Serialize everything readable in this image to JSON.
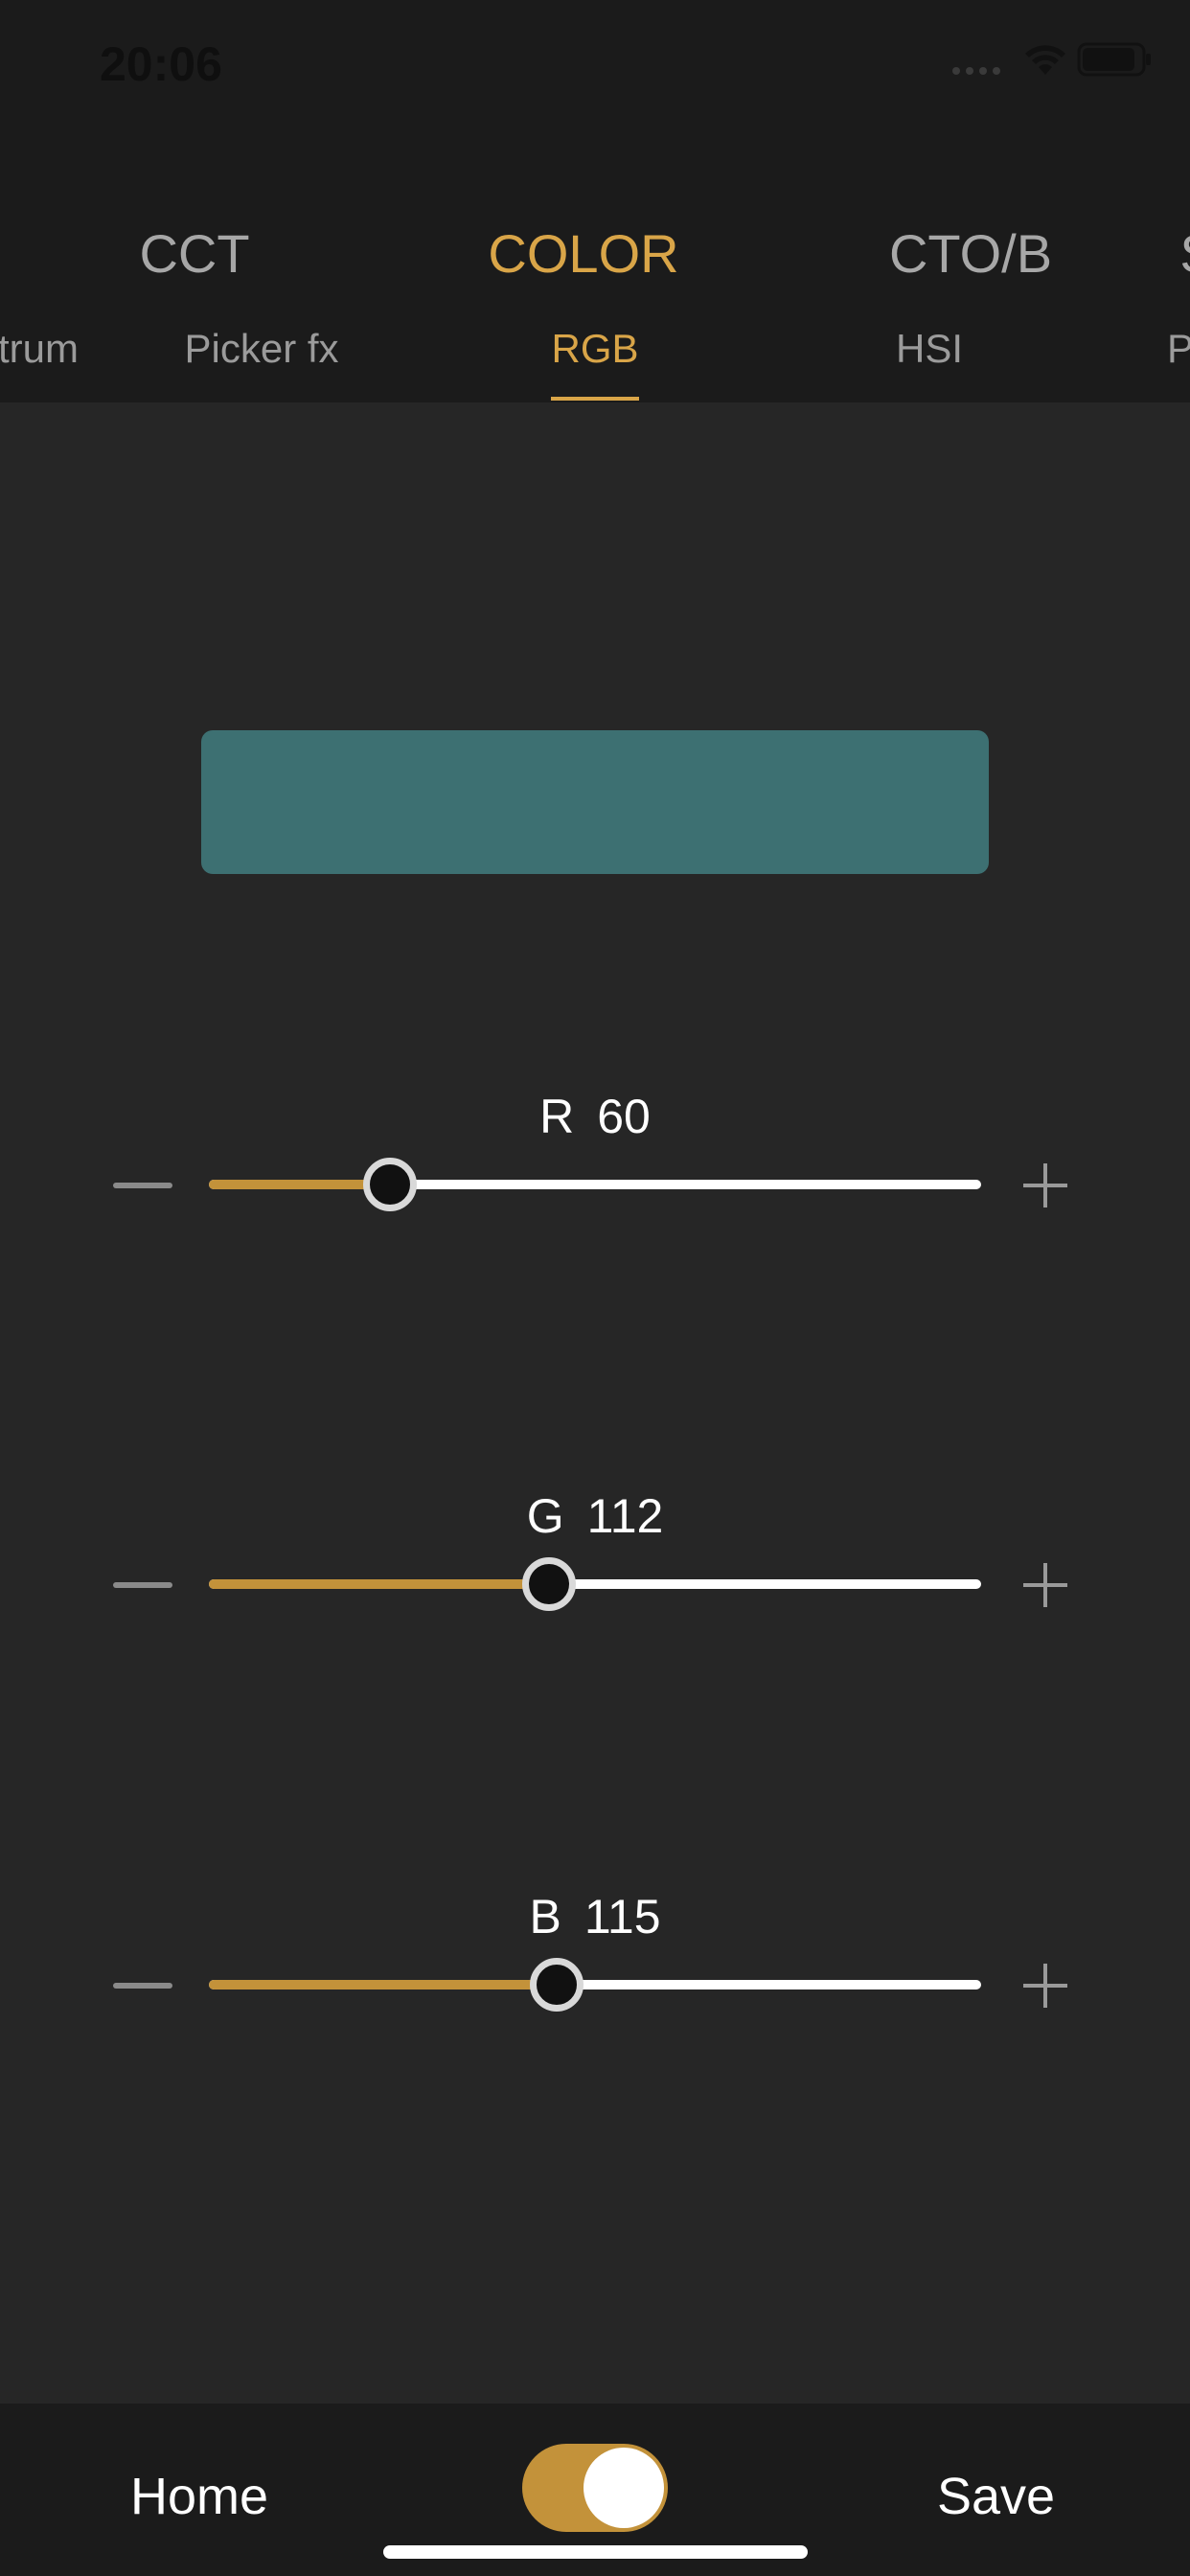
{
  "status_bar": {
    "time": "20:06",
    "icons": [
      "signal-icon",
      "wifi-icon",
      "battery-icon"
    ]
  },
  "main_tabs": [
    {
      "label": "CCT",
      "active": false
    },
    {
      "label": "COLOR",
      "active": true
    },
    {
      "label": "CTO/B",
      "active": false
    },
    {
      "label": "S",
      "active": false
    }
  ],
  "sub_tabs": [
    {
      "label": "trum",
      "active": false
    },
    {
      "label": "Picker fx",
      "active": false
    },
    {
      "label": "RGB",
      "active": true
    },
    {
      "label": "HSI",
      "active": false
    },
    {
      "label": "P",
      "active": false
    }
  ],
  "preview": {
    "color": "#3d7072"
  },
  "sliders": [
    {
      "channel": "R",
      "value": "60",
      "fraction": 0.235
    },
    {
      "channel": "G",
      "value": "112",
      "fraction": 0.44
    },
    {
      "channel": "B",
      "value": "115",
      "fraction": 0.45
    }
  ],
  "bottom_bar": {
    "home_label": "Home",
    "save_label": "Save",
    "toggle_on": true
  },
  "colors": {
    "accent": "#d9a548",
    "fill": "#c3923a",
    "background": "#262626",
    "bar": "#1b1b1b"
  }
}
